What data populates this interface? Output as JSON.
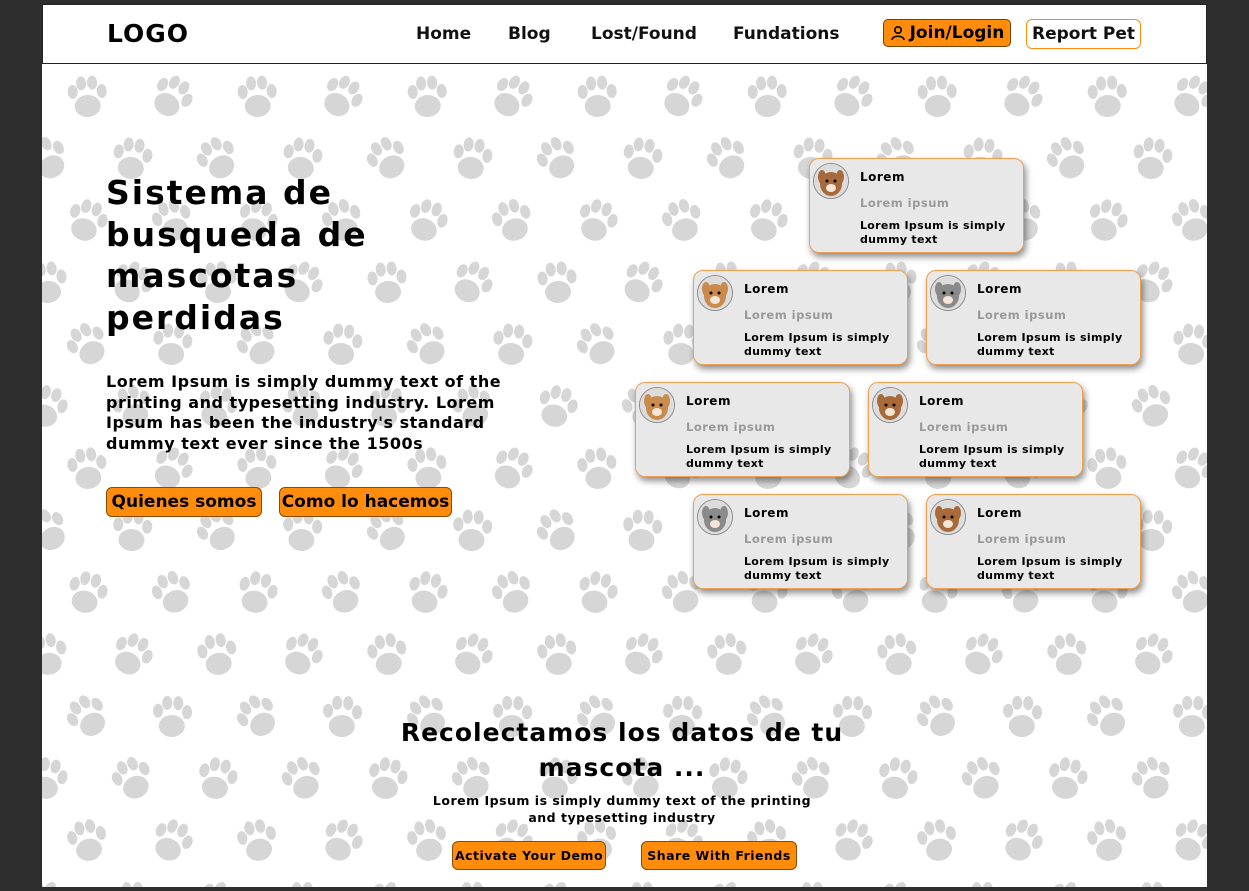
{
  "nav": {
    "logo": "LOGO",
    "links": [
      "Home",
      "Blog",
      "Lost/Found",
      "Fundations"
    ],
    "join_label": "Join/Login",
    "report_label": "Report Pet",
    "join_icon": "user-icon"
  },
  "hero": {
    "title": "Sistema de busqueda de mascotas perdidas",
    "text": "Lorem Ipsum is simply dummy text of the printing and typesetting industry. Lorem Ipsum has been the industry's standard dummy text ever since the 1500s",
    "buttons": [
      "Quienes somos",
      "Como lo hacemos"
    ]
  },
  "cards": [
    {
      "title": "Lorem",
      "subtitle": "Lorem ipsum",
      "text": "Lorem Ipsum is simply dummy text",
      "pet": "dog"
    },
    {
      "title": "Lorem",
      "subtitle": "Lorem ipsum",
      "text": "Lorem Ipsum is simply dummy text",
      "pet": "dog"
    },
    {
      "title": "Lorem",
      "subtitle": "Lorem ipsum",
      "text": "Lorem Ipsum is simply dummy text",
      "pet": "cat"
    },
    {
      "title": "Lorem",
      "subtitle": "Lorem ipsum",
      "text": "Lorem Ipsum is simply dummy text",
      "pet": "dog"
    },
    {
      "title": "Lorem",
      "subtitle": "Lorem ipsum",
      "text": "Lorem Ipsum is simply dummy text",
      "pet": "dog"
    },
    {
      "title": "Lorem",
      "subtitle": "Lorem ipsum",
      "text": "Lorem Ipsum is simply dummy text",
      "pet": "cat"
    },
    {
      "title": "Lorem",
      "subtitle": "Lorem ipsum",
      "text": "Lorem Ipsum is simply dummy text",
      "pet": "dog"
    }
  ],
  "section": {
    "title": "Recolectamos los datos de tu mascota ...",
    "text": "Lorem Ipsum is simply dummy text of the printing and typesetting industry",
    "buttons": [
      "Activate Your Demo",
      "Share With Friends"
    ]
  },
  "colors": {
    "accent": "#ff8c0b",
    "paw": "#d6d6d6",
    "card_bg": "#e8e8e8"
  }
}
